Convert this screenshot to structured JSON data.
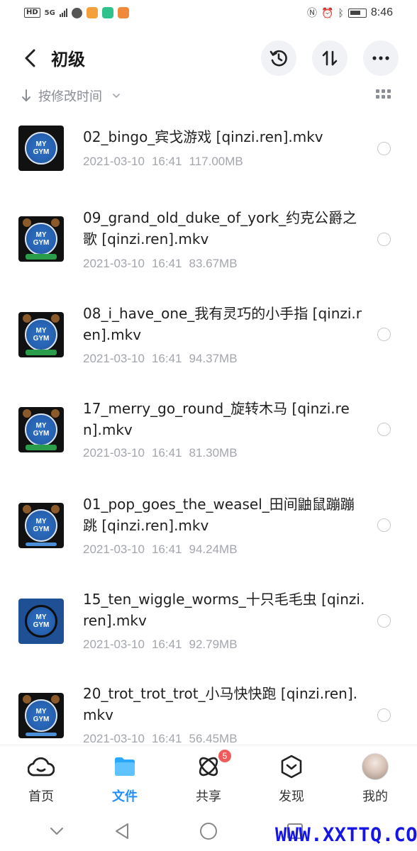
{
  "status_bar": {
    "left_badge": "HD",
    "network": "5G",
    "time": "8:46"
  },
  "header": {
    "title": "初级",
    "history_icon": "history-icon",
    "sort_icon": "sort-icon",
    "more_icon": "more-icon"
  },
  "sort": {
    "label": "按修改时间"
  },
  "files": [
    {
      "name": "02_bingo_宾戈游戏 [qinzi.ren].mkv",
      "date": "2021-03-10",
      "time": "16:41",
      "size": "117.00MB"
    },
    {
      "name": "09_grand_old_duke_of_york_约克公爵之歌 [qinzi.ren].mkv",
      "date": "2021-03-10",
      "time": "16:41",
      "size": "83.67MB"
    },
    {
      "name": "08_i_have_one_我有灵巧的小手指 [qinzi.ren].mkv",
      "date": "2021-03-10",
      "time": "16:41",
      "size": "94.37MB"
    },
    {
      "name": "17_merry_go_round_旋转木马 [qinzi.ren].mkv",
      "date": "2021-03-10",
      "time": "16:41",
      "size": "81.30MB"
    },
    {
      "name": "01_pop_goes_the_weasel_田间鼬鼠蹦蹦跳 [qinzi.ren].mkv",
      "date": "2021-03-10",
      "time": "16:41",
      "size": "94.24MB"
    },
    {
      "name": "15_ten_wiggle_worms_十只毛毛虫 [qinzi.ren].mkv",
      "date": "2021-03-10",
      "time": "16:41",
      "size": "92.79MB"
    },
    {
      "name": "20_trot_trot_trot_小马快快跑 [qinzi.ren].mkv",
      "date": "2021-03-10",
      "time": "16:41",
      "size": "56.45MB"
    }
  ],
  "thumb_text": {
    "l1": "MY",
    "l2": "GYM"
  },
  "nav": {
    "home": "首页",
    "files": "文件",
    "share": "共享",
    "share_badge": "5",
    "discover": "发现",
    "mine": "我的"
  },
  "colors": {
    "accent": "#1f8fff",
    "badge": "#f05a5a",
    "meta_text": "#a3a6ad"
  },
  "watermark": "WWW.XXTTQ.COM"
}
